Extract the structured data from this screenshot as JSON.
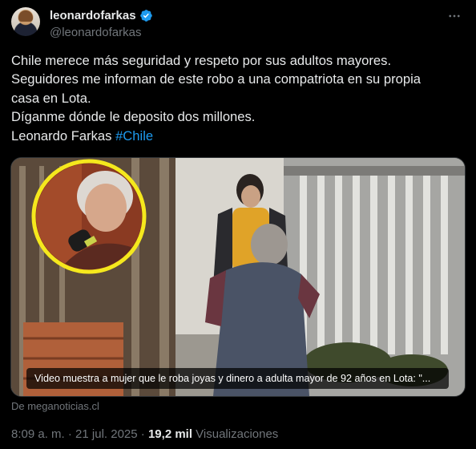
{
  "author": {
    "display_name": "leonardofarkas",
    "handle": "@leonardofarkas",
    "verified": true,
    "avatar_icon": "profile-photo",
    "more_icon": "more-options-icon"
  },
  "tweet": {
    "lines": [
      "Chile merece más seguridad y respeto por sus adultos mayores.",
      "Seguidores me informan de este robo a una compatriota en su propia",
      "casa en Lota.",
      "Díganme dónde le deposito dos millones.",
      "Leonardo Farkas "
    ],
    "hashtag": "#Chile"
  },
  "media": {
    "caption": "Video muestra a mujer que le roba joyas y dinero a adulta mayor de 92 años en Lota: \"...",
    "source": "De meganoticias.cl"
  },
  "meta": {
    "time": "8:09 a. m.",
    "separator": " · ",
    "date": "21 jul. 2025",
    "views_count": "19,2 mil",
    "views_label": " Visualizaciones"
  },
  "colors": {
    "background": "#000000",
    "text": "#e7e9ea",
    "secondary": "#71767b",
    "link": "#1d9bf0",
    "verified": "#1d9bf0"
  }
}
